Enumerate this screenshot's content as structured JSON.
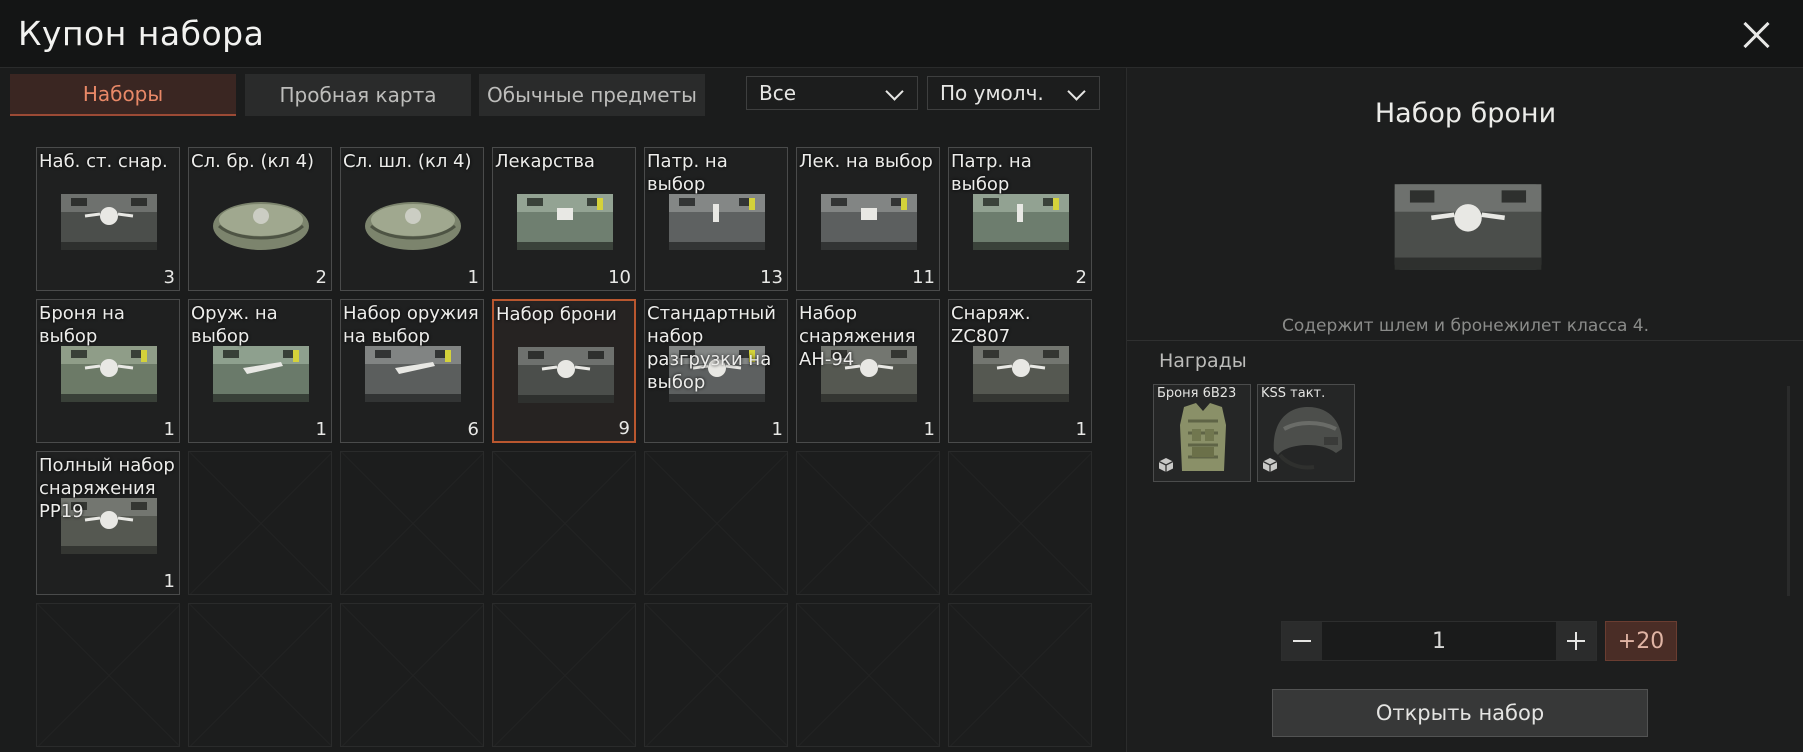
{
  "window": {
    "title": "Купон набора"
  },
  "tabs": [
    {
      "label": "Наборы",
      "active": true
    },
    {
      "label": "Пробная карта",
      "active": false
    },
    {
      "label": "Обычные предметы",
      "active": false
    }
  ],
  "filters": {
    "category_value": "Все",
    "sort_value": "По умолч."
  },
  "items": [
    {
      "label": "Наб. ст. снар.",
      "count": "3",
      "icon": "digital-camo-crate"
    },
    {
      "label": "Сл. бр. (кл 4)",
      "count": "2",
      "icon": "green-duffel-bag"
    },
    {
      "label": "Сл. шл. (кл 4)",
      "count": "1",
      "icon": "green-duffel-bag"
    },
    {
      "label": "Лекарства",
      "count": "10",
      "icon": "green-crate-medical"
    },
    {
      "label": "Патр. на выбор",
      "count": "13",
      "icon": "gray-crate-ammo"
    },
    {
      "label": "Лек. на выбор",
      "count": "11",
      "icon": "gray-crate-medical"
    },
    {
      "label": "Патр. на выбор",
      "count": "2",
      "icon": "green-crate-ammo"
    },
    {
      "label": "Броня на выбор",
      "count": "1",
      "icon": "green-crate-armor"
    },
    {
      "label": "Оруж. на выбор",
      "count": "1",
      "icon": "green-crate-weapon"
    },
    {
      "label": "Набор оружия на выбор",
      "count": "6",
      "icon": "gray-crate-weapon"
    },
    {
      "label": "Набор брони",
      "count": "9",
      "icon": "digital-camo-crate",
      "selected": true
    },
    {
      "label": "Стандартный набор разгрузки на выбор",
      "count": "1",
      "icon": "gray-crate-rig"
    },
    {
      "label": "Набор снаряжения АН-94",
      "count": "1",
      "icon": "camo-crate"
    },
    {
      "label": "Снаряж. ZC807",
      "count": "1",
      "icon": "camo-crate"
    },
    {
      "label": "Полный набор снаряжения PP19",
      "count": "1",
      "icon": "camo-crate"
    }
  ],
  "detail": {
    "title": "Набор брони",
    "image_icon": "digital-camo-crate",
    "description": "Содержит шлем и бронежилет класса 4.",
    "rewards_label": "Награды",
    "rewards": [
      {
        "label": "Броня 6В23",
        "icon": "body-armor-vest"
      },
      {
        "label": "KSS такт.",
        "icon": "tactical-helmet"
      }
    ],
    "quantity": "1",
    "plus_label": "+20",
    "open_label": "Открыть набор"
  },
  "colors": {
    "accent": "#b9572f",
    "active_tab_text": "#e88867",
    "active_tab_bg": "#3a2622",
    "panel_bg": "#1b1c1c"
  }
}
